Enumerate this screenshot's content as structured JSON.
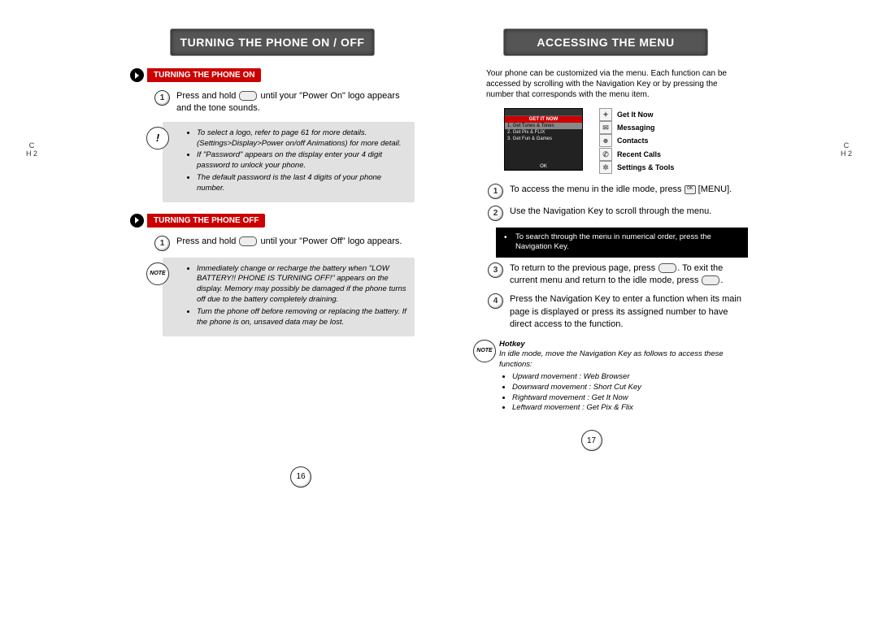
{
  "left": {
    "banner": "TURNING THE PHONE ON / OFF",
    "section_on": "TURNING THE PHONE ON",
    "on_step1": "Press and hold [END] until your \"Power On\" logo appears and the tone sounds.",
    "on_note_items": [
      "To select a logo, refer to page 61 for more details. (Settings>Display>Power on/off Animations) for more detail.",
      "If \"Password\" appears on the display enter your 4 digit password to unlock your phone.",
      "The default password is the last 4 digits of your phone number."
    ],
    "section_off": "TURNING THE PHONE OFF",
    "off_step1": "Press and hold [END] until your \"Power Off\" logo appears.",
    "off_note_items": [
      "Immediately change or recharge the battery when \"LOW BATTERY!! PHONE IS TURNING OFF!\" appears on the display. Memory may possibly be damaged if the phone turns off due to the battery completely draining.",
      "Turn the phone off before removing or replacing the battery. If the phone is on, unsaved data may be lost."
    ],
    "page_num": "16",
    "side_tab": "C H 2"
  },
  "right": {
    "banner": "ACCESSING THE MENU",
    "intro": "Your phone can be customized via the menu. Each function can be accessed by scrolling with the Navigation Key or by pressing the number that corresponds with the menu item.",
    "screen_title": "GET IT NOW",
    "screen_items": [
      "1. Get Tunes & Tones",
      "2. Get Pix & FLIX",
      "3. Get Fun & Games"
    ],
    "screen_ok": "OK",
    "menu_items": [
      {
        "icon": "✦",
        "label": "Get It Now"
      },
      {
        "icon": "✉",
        "label": "Messaging"
      },
      {
        "icon": "☻",
        "label": "Contacts"
      },
      {
        "icon": "✆",
        "label": "Recent Calls"
      },
      {
        "icon": "✲",
        "label": "Settings & Tools"
      }
    ],
    "step1": "To access the menu in the idle mode, press [OK] [MENU].",
    "step2": "Use the Navigation Key to scroll through the menu.",
    "tip": "To search through the menu in numerical order, press the Navigation Key.",
    "step3": "To return to the previous page, press [CLR]. To exit the current menu and return to the idle mode, press [END].",
    "step4": "Press the Navigation Key to enter a function when its main page is displayed or press its assigned number to have direct access to the function.",
    "hotkey_title": "Hotkey",
    "hotkey_intro": "In idle mode, move the Navigation Key as follows to access these functions:",
    "hotkey_items": [
      "Upward movement : Web Browser",
      "Downward movement : Short Cut Key",
      "Rightward movement : Get It Now",
      "Leftward movement : Get Pix & Flix"
    ],
    "page_num": "17",
    "side_tab": "C H 2"
  }
}
